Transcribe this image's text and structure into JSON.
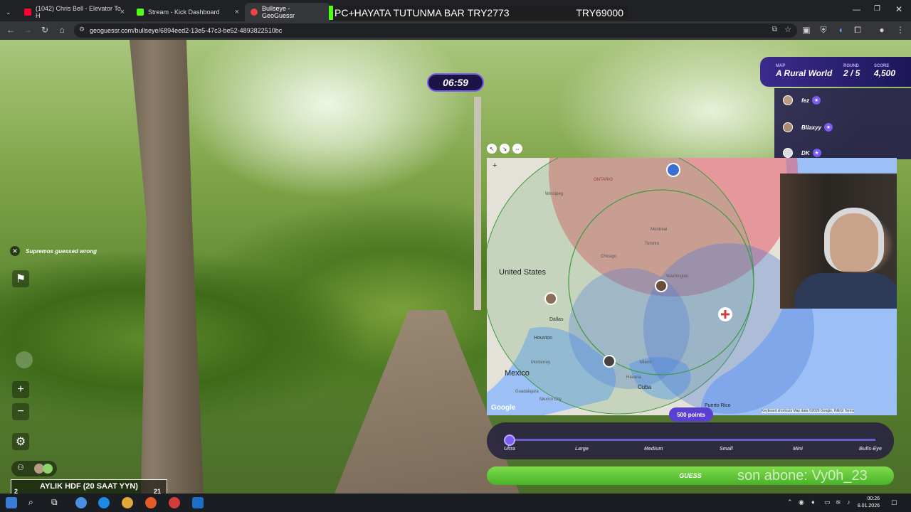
{
  "browser": {
    "tabs": [
      {
        "title": "(1042) Chris Bell - Elevator To H",
        "fav_color": "#ff0033"
      },
      {
        "title": "Stream - Kick Dashboard",
        "fav_color": "#53fc18"
      },
      {
        "title": "Bullseye - GeoGuessr",
        "fav_color": "#e84545"
      }
    ],
    "overlay_text": "PC+HAYATA TUTUNMA BAR",
    "overlay_counter": "TRY2773",
    "overlay_goal": "TRY69000",
    "url": "geoguessr.com/bullseye/6894eed2-13e5-47c3-be52-4893822510bc"
  },
  "game": {
    "timer": "06:59",
    "toast": "Supremos guessed wrong",
    "map_label": "MAP",
    "map_value": "A Rural World",
    "round_label": "ROUND",
    "round_value": "2 / 5",
    "score_label": "SCORE",
    "score_value": "4,500",
    "players": [
      {
        "name": "fez"
      },
      {
        "name": "Bllaxyy"
      },
      {
        "name": "DK"
      }
    ],
    "points_badge": "500 points",
    "slider_labels": [
      "Ultra",
      "Large",
      "Medium",
      "Small",
      "Mini",
      "Bulls-Eye"
    ],
    "guess_button": "GUESS",
    "map_labels": {
      "us": "United States",
      "mexico": "Mexico",
      "cuba": "Cuba",
      "winnipeg": "Winnipeg",
      "ontario": "ONTARIO",
      "montreal": "Montreal",
      "toronto": "Toronto",
      "washington": "Washington",
      "chicago": "Chicago",
      "dallas": "Dallas",
      "houston": "Houston",
      "miami": "Miami",
      "monterrey": "Monterrey",
      "guadalajara": "Guadalajara",
      "mexico_city": "Mexico City",
      "havana": "Havana",
      "puerto_rico": "Puerto Rico",
      "google": "Google",
      "attribution": "Keyboard shortcuts   Map data ©2026 Google, INEGI   Terms"
    }
  },
  "stream": {
    "last_sub": "son abone: Vy0h_23",
    "sub_box_line": "AYLIK HDF (20 SAAT YYN)",
    "sub_box_left": "2",
    "sub_box_right": "21"
  },
  "taskbar": {
    "time": "00:26",
    "date": "8.01.2026"
  },
  "colors": {
    "accent": "#7b5cf5",
    "guess_green": "#49b22a",
    "circle_red": "#e85a6a",
    "circle_blue": "#4a78d8"
  }
}
